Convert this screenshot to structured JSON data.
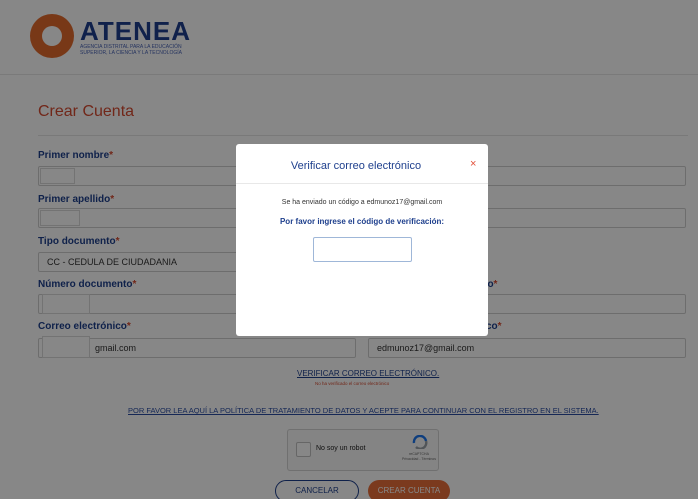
{
  "header": {
    "brand_title": "ATENEA",
    "brand_subtitle": "AGENCIA DISTRITAL PARA LA EDUCACIÓN SUPERIOR, LA CIENCIA Y LA TECNOLOGÍA"
  },
  "form": {
    "title": "Crear Cuenta",
    "required_mark": "*",
    "fields": {
      "primer_nombre": {
        "label": "Primer nombre"
      },
      "primer_apellido": {
        "label": "Primer apellido"
      },
      "tipo_documento": {
        "label": "Tipo documento",
        "value": "CC - CEDULA DE CIUDADANIA"
      },
      "numero_documento": {
        "label": "Número documento"
      },
      "numero_documento_confirm": {
        "label_fragment": "nto"
      },
      "correo": {
        "label": "Correo electrónico",
        "value_fragment": "gmail.com"
      },
      "correo_confirm": {
        "label_fragment": "co",
        "value": "edmunoz17@gmail.com"
      }
    },
    "verify_link": "VERIFICAR CORREO ELECTRÓNICO.",
    "verify_note": "No ha verificado el correo electrónico",
    "policy_text": "POR FAVOR LEA AQUÍ LA POLÍTICA DE TRATAMIENTO DE DATOS Y ACEPTE PARA CONTINUAR CON EL REGISTRO EN EL SISTEMA.",
    "captcha": {
      "label": "No soy un robot",
      "brand": "reCAPTCHA",
      "links": "Privacidad - Términos",
      "accent": "#1c75ef"
    },
    "cancel_label": "CANCELAR",
    "create_label": "CREAR CUENTA"
  },
  "modal": {
    "title": "Verificar correo electrónico",
    "close_icon": "close-icon",
    "close_glyph": "×",
    "sent_text": "Se ha enviado un código a edmunoz17@gmail.com",
    "prompt": "Por favor ingrese el código de verificación:",
    "code_value": ""
  },
  "colors": {
    "brand_blue": "#1e3f8d",
    "accent_orange": "#e86f3a",
    "title_red": "#d64a30",
    "overlay": "rgba(0,0,0,0.47)"
  }
}
